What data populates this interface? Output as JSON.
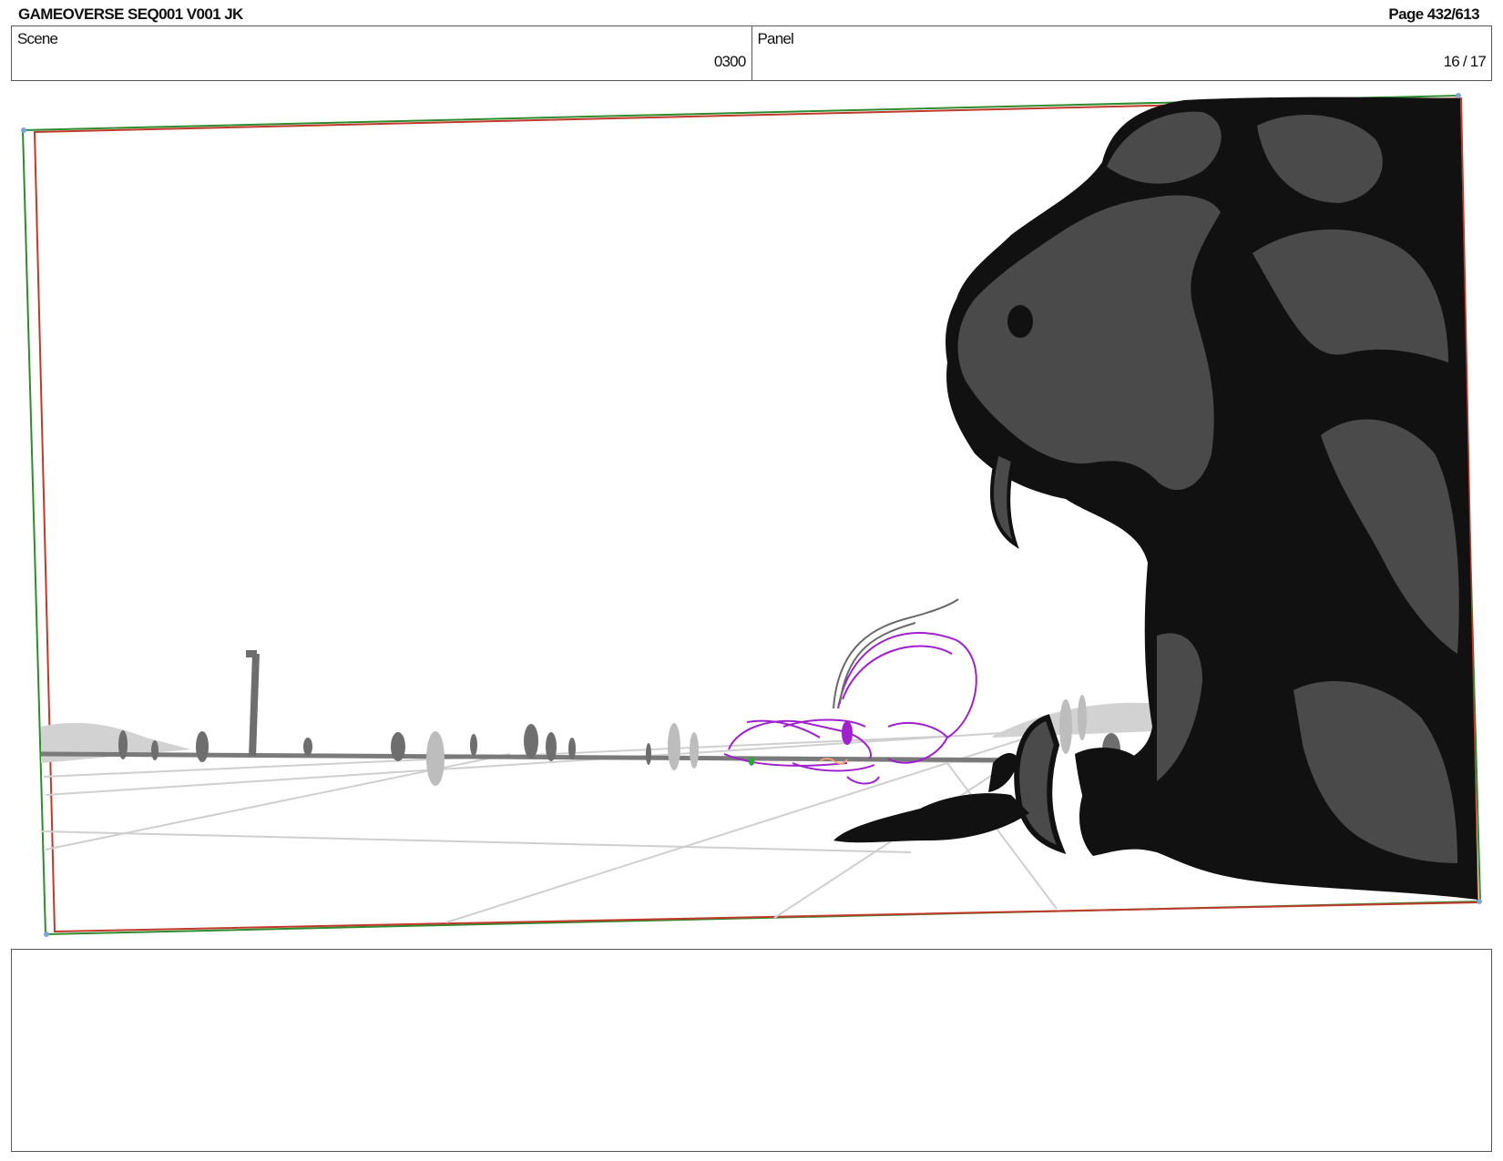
{
  "header": {
    "title": "GAMEOVERSE SEQ001 V001 JK",
    "page": "Page 432/613"
  },
  "info": {
    "scene_label": "Scene",
    "scene_value": "0300",
    "panel_label": "Panel",
    "panel_value": "16 / 17"
  },
  "panel_image": {
    "description_icon": "storyboard-sketch",
    "colors": {
      "frame_outer": "#2e8b2e",
      "frame_inner": "#c0392b",
      "creature": "#111111",
      "creature_shade": "#4a4a4a",
      "character_sketch": "#a020d0",
      "horizon": "#777777"
    }
  },
  "notes": {
    "text": ""
  }
}
